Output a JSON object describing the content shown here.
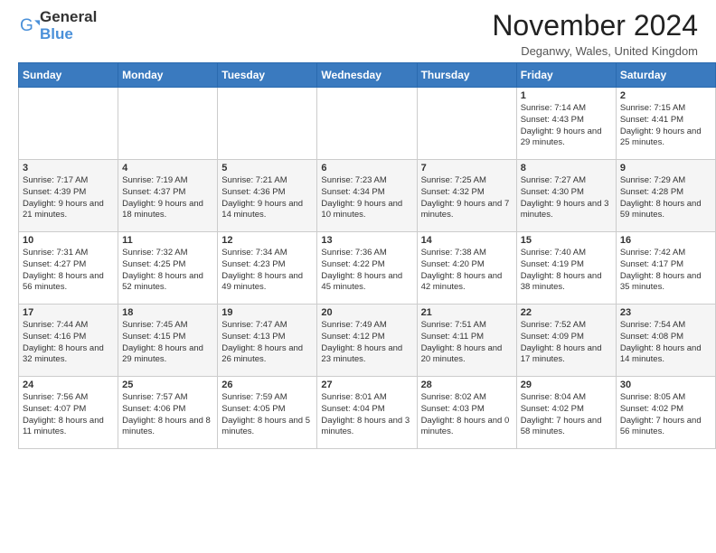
{
  "header": {
    "logo_general": "General",
    "logo_blue": "Blue",
    "month_title": "November 2024",
    "location": "Deganwy, Wales, United Kingdom"
  },
  "calendar": {
    "days_of_week": [
      "Sunday",
      "Monday",
      "Tuesday",
      "Wednesday",
      "Thursday",
      "Friday",
      "Saturday"
    ],
    "weeks": [
      [
        {
          "day": "",
          "info": ""
        },
        {
          "day": "",
          "info": ""
        },
        {
          "day": "",
          "info": ""
        },
        {
          "day": "",
          "info": ""
        },
        {
          "day": "",
          "info": ""
        },
        {
          "day": "1",
          "info": "Sunrise: 7:14 AM\nSunset: 4:43 PM\nDaylight: 9 hours and 29 minutes."
        },
        {
          "day": "2",
          "info": "Sunrise: 7:15 AM\nSunset: 4:41 PM\nDaylight: 9 hours and 25 minutes."
        }
      ],
      [
        {
          "day": "3",
          "info": "Sunrise: 7:17 AM\nSunset: 4:39 PM\nDaylight: 9 hours and 21 minutes."
        },
        {
          "day": "4",
          "info": "Sunrise: 7:19 AM\nSunset: 4:37 PM\nDaylight: 9 hours and 18 minutes."
        },
        {
          "day": "5",
          "info": "Sunrise: 7:21 AM\nSunset: 4:36 PM\nDaylight: 9 hours and 14 minutes."
        },
        {
          "day": "6",
          "info": "Sunrise: 7:23 AM\nSunset: 4:34 PM\nDaylight: 9 hours and 10 minutes."
        },
        {
          "day": "7",
          "info": "Sunrise: 7:25 AM\nSunset: 4:32 PM\nDaylight: 9 hours and 7 minutes."
        },
        {
          "day": "8",
          "info": "Sunrise: 7:27 AM\nSunset: 4:30 PM\nDaylight: 9 hours and 3 minutes."
        },
        {
          "day": "9",
          "info": "Sunrise: 7:29 AM\nSunset: 4:28 PM\nDaylight: 8 hours and 59 minutes."
        }
      ],
      [
        {
          "day": "10",
          "info": "Sunrise: 7:31 AM\nSunset: 4:27 PM\nDaylight: 8 hours and 56 minutes."
        },
        {
          "day": "11",
          "info": "Sunrise: 7:32 AM\nSunset: 4:25 PM\nDaylight: 8 hours and 52 minutes."
        },
        {
          "day": "12",
          "info": "Sunrise: 7:34 AM\nSunset: 4:23 PM\nDaylight: 8 hours and 49 minutes."
        },
        {
          "day": "13",
          "info": "Sunrise: 7:36 AM\nSunset: 4:22 PM\nDaylight: 8 hours and 45 minutes."
        },
        {
          "day": "14",
          "info": "Sunrise: 7:38 AM\nSunset: 4:20 PM\nDaylight: 8 hours and 42 minutes."
        },
        {
          "day": "15",
          "info": "Sunrise: 7:40 AM\nSunset: 4:19 PM\nDaylight: 8 hours and 38 minutes."
        },
        {
          "day": "16",
          "info": "Sunrise: 7:42 AM\nSunset: 4:17 PM\nDaylight: 8 hours and 35 minutes."
        }
      ],
      [
        {
          "day": "17",
          "info": "Sunrise: 7:44 AM\nSunset: 4:16 PM\nDaylight: 8 hours and 32 minutes."
        },
        {
          "day": "18",
          "info": "Sunrise: 7:45 AM\nSunset: 4:15 PM\nDaylight: 8 hours and 29 minutes."
        },
        {
          "day": "19",
          "info": "Sunrise: 7:47 AM\nSunset: 4:13 PM\nDaylight: 8 hours and 26 minutes."
        },
        {
          "day": "20",
          "info": "Sunrise: 7:49 AM\nSunset: 4:12 PM\nDaylight: 8 hours and 23 minutes."
        },
        {
          "day": "21",
          "info": "Sunrise: 7:51 AM\nSunset: 4:11 PM\nDaylight: 8 hours and 20 minutes."
        },
        {
          "day": "22",
          "info": "Sunrise: 7:52 AM\nSunset: 4:09 PM\nDaylight: 8 hours and 17 minutes."
        },
        {
          "day": "23",
          "info": "Sunrise: 7:54 AM\nSunset: 4:08 PM\nDaylight: 8 hours and 14 minutes."
        }
      ],
      [
        {
          "day": "24",
          "info": "Sunrise: 7:56 AM\nSunset: 4:07 PM\nDaylight: 8 hours and 11 minutes."
        },
        {
          "day": "25",
          "info": "Sunrise: 7:57 AM\nSunset: 4:06 PM\nDaylight: 8 hours and 8 minutes."
        },
        {
          "day": "26",
          "info": "Sunrise: 7:59 AM\nSunset: 4:05 PM\nDaylight: 8 hours and 5 minutes."
        },
        {
          "day": "27",
          "info": "Sunrise: 8:01 AM\nSunset: 4:04 PM\nDaylight: 8 hours and 3 minutes."
        },
        {
          "day": "28",
          "info": "Sunrise: 8:02 AM\nSunset: 4:03 PM\nDaylight: 8 hours and 0 minutes."
        },
        {
          "day": "29",
          "info": "Sunrise: 8:04 AM\nSunset: 4:02 PM\nDaylight: 7 hours and 58 minutes."
        },
        {
          "day": "30",
          "info": "Sunrise: 8:05 AM\nSunset: 4:02 PM\nDaylight: 7 hours and 56 minutes."
        }
      ]
    ]
  }
}
